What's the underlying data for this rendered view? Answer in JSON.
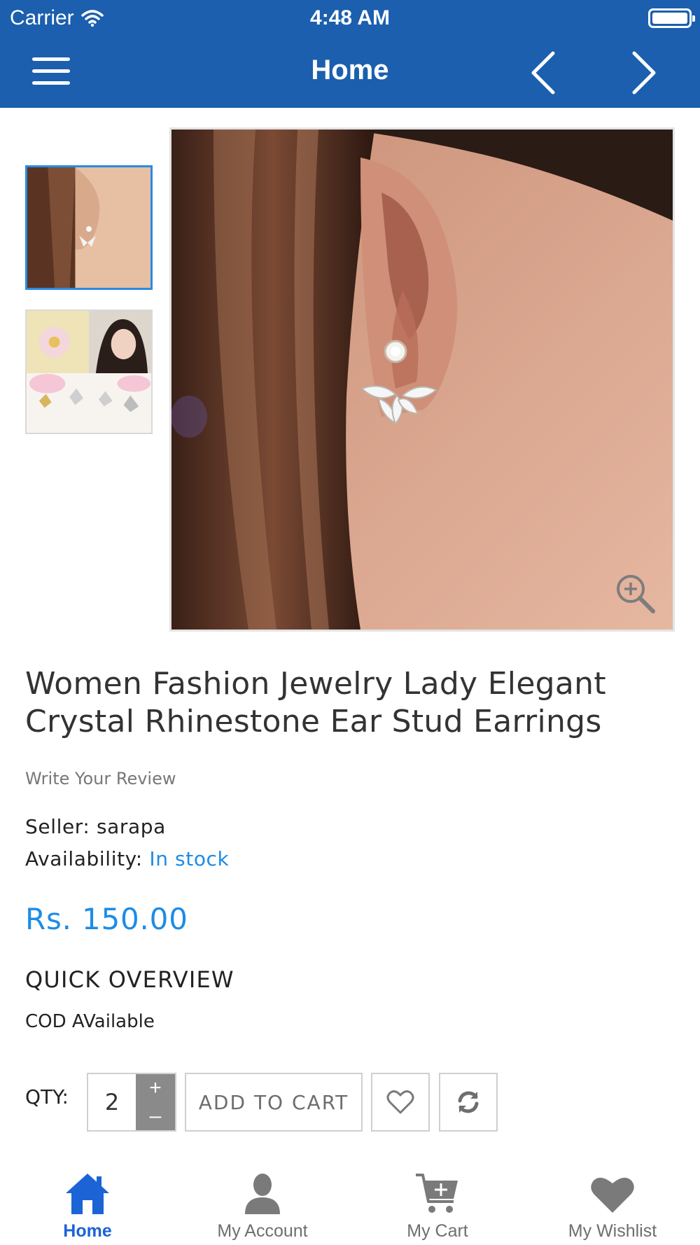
{
  "status_bar": {
    "carrier": "Carrier",
    "time": "4:48 AM"
  },
  "nav": {
    "title": "Home",
    "menu_icon": "hamburger-menu-icon",
    "prev_icon": "chevron-left-icon",
    "next_icon": "chevron-right-icon"
  },
  "colors": {
    "header": "#1b5fae",
    "accent": "#1d8ce6",
    "tab_active": "#1c63d6",
    "tab_inactive": "#6e6e6e"
  },
  "gallery": {
    "thumbnails": [
      {
        "label": "earring-on-ear-thumbnail",
        "selected": true
      },
      {
        "label": "earring-collection-thumbnail",
        "selected": false
      }
    ],
    "zoom_icon": "zoom-in-icon"
  },
  "product": {
    "title": "Women Fashion Jewelry Lady Elegant Crystal Rhinestone Ear Stud Earrings",
    "review_link": "Write Your Review",
    "seller_label": "Seller:",
    "seller_value": "sarapa",
    "availability_label": "Availability:",
    "availability_value": "In stock",
    "price": "Rs. 150.00",
    "overview_heading": "QUICK OVERVIEW",
    "overview_text": "COD AVailable"
  },
  "purchase": {
    "qty_label": "QTY:",
    "qty_value": "2",
    "plus": "+",
    "minus": "–",
    "add_to_cart": "ADD TO CART",
    "wishlist_icon": "heart-outline-icon",
    "compare_icon": "refresh-compare-icon"
  },
  "tabs": [
    {
      "label": "Home",
      "icon": "home-icon",
      "active": true
    },
    {
      "label": "My Account",
      "icon": "user-icon",
      "active": false
    },
    {
      "label": "My Cart",
      "icon": "cart-icon",
      "active": false
    },
    {
      "label": "My Wishlist",
      "icon": "heart-icon",
      "active": false
    }
  ]
}
